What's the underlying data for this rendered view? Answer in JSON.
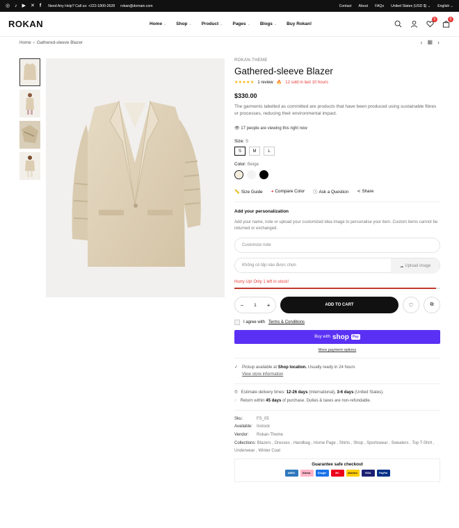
{
  "topbar": {
    "help": "Need Any Help? Call us: +222-1800-2628",
    "email": "rokan@domain.com",
    "links": [
      "Contact",
      "About",
      "FAQs",
      "United States (USD $)",
      "English"
    ]
  },
  "header": {
    "logo": "ROKAN",
    "nav": [
      "Home",
      "Shop",
      "Product",
      "Pages",
      "Blogs",
      "Buy Rokan!"
    ],
    "wishlist_count": "0",
    "cart_count": "0"
  },
  "breadcrumb": {
    "home": "Home",
    "current": "Gathered-sleeve Blazer"
  },
  "product": {
    "vendor": "ROKAN-THEME",
    "title": "Gathered-sleeve Blazer",
    "stars": "★★★★★",
    "reviews": "1 review",
    "sold": "12 sold in last 10 hours",
    "price": "$330.00",
    "description": "The garments labelled as committed are products that have been produced using sustainable fibres or processes, reducing their environmental impact.",
    "viewing": "17 people are viewing this right now",
    "size_label": "Size:",
    "size_value": "S",
    "sizes": [
      "S",
      "M",
      "L"
    ],
    "color_label": "Color:",
    "color_value": "Beige",
    "tools": [
      "Size Guide",
      "Compare Color",
      "Ask a Question",
      "Share"
    ]
  },
  "personalization": {
    "title": "Add your personalization",
    "note": "Add your name, note or upload your customized idea image to personalise your item. Custom items cannot be returned or exchanged.",
    "customize_placeholder": "Customize note",
    "file_text": "Không có tệp nào được chọn",
    "upload_label": "Upload image"
  },
  "stock": {
    "text": "Hurry Up! Only 1 left in stock!",
    "fill_fraction": 0.98
  },
  "cart": {
    "qty": "1",
    "add_to_cart": "ADD TO CART",
    "agree_text": "I agree with",
    "terms": "Terms & Conditions",
    "buy_with": "Buy with",
    "shop": "shop",
    "pay": "Pay",
    "more_payment": "More payment options"
  },
  "pickup": {
    "line1_pre": "Pickup available at",
    "location": "Shop location.",
    "line1_post": "Usually ready in 24 hours",
    "view_store": "View store information"
  },
  "delivery": {
    "estimate_pre": "Estimate delivery times:",
    "intl_days": "12-26 days",
    "intl_label": "(International),",
    "us_days": "3-6 days",
    "us_label": "(United States).",
    "return_pre": "Return within",
    "return_days": "45 days",
    "return_post": "of purchase. Duties & taxes are non-refundable."
  },
  "details": {
    "sku_label": "Sku:",
    "sku": "FS_05",
    "available_label": "Available:",
    "available": "Instock",
    "vendor_label": "Vendor:",
    "vendor": "Rokan-Theme",
    "collections_label": "Collections:",
    "collections": "Blazers , Dresses , Handbag , Home Page , Shirts , Shop , Sportswear , Sweaters , Top T-Shirt , Underwear , Winter Coat"
  },
  "checkout": {
    "title": "Guarantee safe checkout",
    "cards": [
      {
        "name": "AMEX",
        "color": "#2e77bc"
      },
      {
        "name": "Klarna.",
        "color": "#ffb3c7"
      },
      {
        "name": "Google",
        "color": "#1a73e8"
      },
      {
        "name": "MC",
        "color": "#eb001b"
      },
      {
        "name": "maestro",
        "color": "#ffcc00"
      },
      {
        "name": "VISA",
        "color": "#1a1f71"
      },
      {
        "name": "PayPal",
        "color": "#003087"
      }
    ]
  }
}
